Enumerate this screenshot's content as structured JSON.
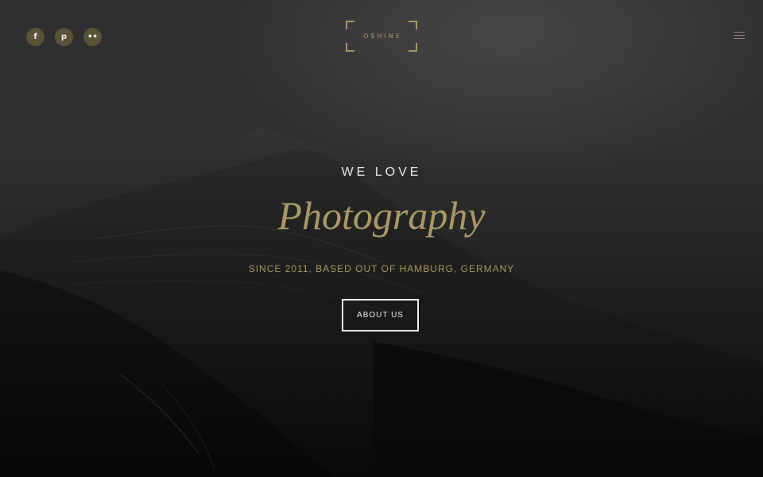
{
  "header": {
    "social_links": [
      {
        "icon": "facebook-icon",
        "glyph": "f"
      },
      {
        "icon": "pinterest-icon",
        "glyph": "p"
      },
      {
        "icon": "flickr-icon",
        "glyph": "••"
      }
    ],
    "logo_text": "OSHINE",
    "menu_icon": "hamburger-menu-icon"
  },
  "hero": {
    "pre_title": "WE LOVE",
    "title": "Photography",
    "subtitle": "SINCE 2011, BASED OUT OF HAMBURG, GERMANY",
    "cta_label": "ABOUT US"
  },
  "colors": {
    "accent": "#a99866",
    "social_bg": "#5b5238",
    "text_light": "#ece9e1"
  }
}
